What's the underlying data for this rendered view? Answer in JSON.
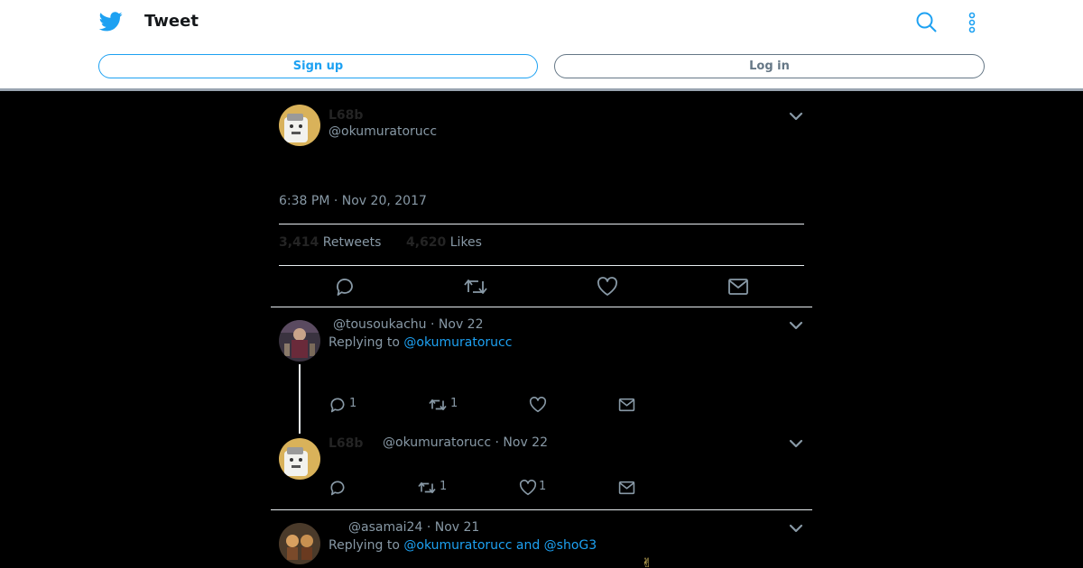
{
  "header": {
    "title": "Tweet",
    "signup_label": "Sign up",
    "login_label": "Log in",
    "accent": "#1da1f2"
  },
  "main_tweet": {
    "name": "L68b",
    "handle": "@okumuratorucc",
    "timestamp": "6:38 PM · Nov 20, 2017",
    "retweets_count": "3,414",
    "retweets_label": "Retweets",
    "likes_count": "4,620",
    "likes_label": "Likes"
  },
  "replies": [
    {
      "handle": "@tousoukachu",
      "date": "Nov 22",
      "replying_prefix": "Replying to",
      "replying_to": "@okumuratorucc",
      "reply_count": "1",
      "retweet_count": "1"
    },
    {
      "name": "L68b",
      "handle": "@okumuratorucc",
      "date": "Nov 22",
      "retweet_count": "1",
      "like_count": "1"
    },
    {
      "handle": "@asamai24",
      "date": "Nov 21",
      "replying_prefix": "Replying to",
      "replying_to": "@okumuratorucc and @shoG3"
    }
  ]
}
